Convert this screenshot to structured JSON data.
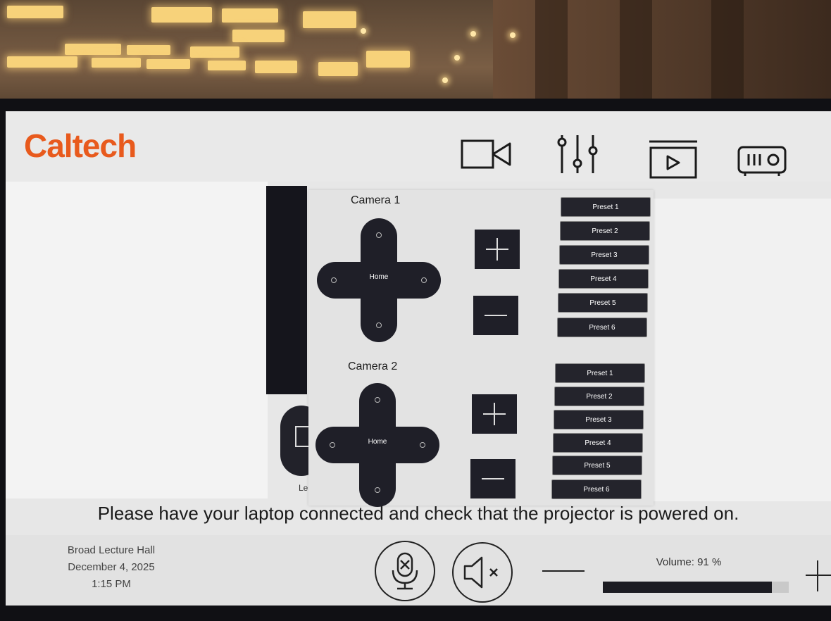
{
  "header": {
    "logo": "Caltech",
    "icons": [
      "camera-icon",
      "mixer-sliders-icon",
      "play-source-icon",
      "projector-icon"
    ]
  },
  "background": {
    "source_tile_label": "Le"
  },
  "cameras": [
    {
      "title": "Camera 1",
      "home_label": "Home",
      "presets": [
        "Preset 1",
        "Preset 2",
        "Preset 3",
        "Preset 4",
        "Preset 5",
        "Preset 6"
      ]
    },
    {
      "title": "Camera 2",
      "home_label": "Home",
      "presets": [
        "Preset 1",
        "Preset 2",
        "Preset 3",
        "Preset 4",
        "Preset 5",
        "Preset 6"
      ]
    }
  ],
  "message": "Please have your laptop connected and check that the projector is powered on.",
  "footer": {
    "room": "Broad Lecture Hall",
    "date": "December 4, 2025",
    "time": "1:15 PM",
    "volume_label": "Volume: 91 %",
    "volume_level": 0.91
  },
  "colors": {
    "brand": "#e85a1d",
    "button": "#1f1f28"
  }
}
